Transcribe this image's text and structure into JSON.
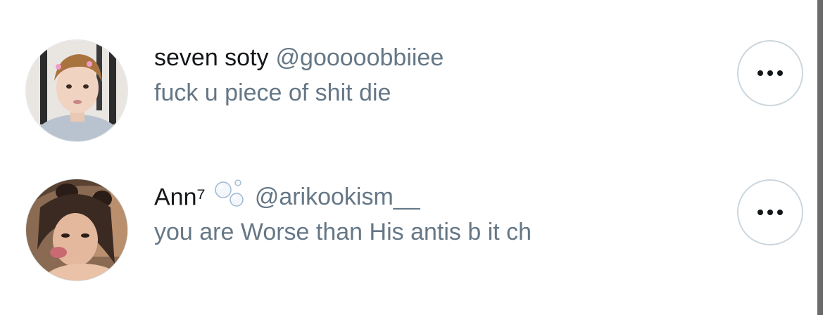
{
  "comments": [
    {
      "display_name": "seven soty",
      "handle": "@gooooobbiiee",
      "text": "fuck u piece of shit die",
      "avatar_icon": "avatar-photo",
      "more_icon": "more-options-icon"
    },
    {
      "display_name": "Ann⁷",
      "handle": "@arikookism__",
      "text": "you are Worse than His antis b it ch",
      "avatar_icon": "avatar-photo",
      "name_emoji": "bubbles-icon",
      "more_icon": "more-options-icon"
    }
  ],
  "colors": {
    "name": "#14171a",
    "secondary": "#657786",
    "button_border": "#ccd6dd",
    "scrollbar": "#6b6b6b"
  }
}
